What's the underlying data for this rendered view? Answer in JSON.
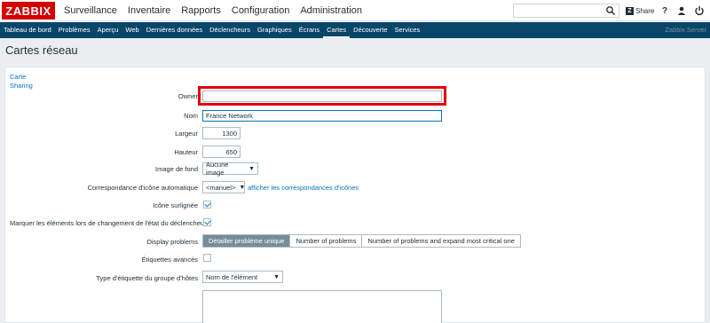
{
  "topbar": {
    "logo": "ZABBIX",
    "nav": [
      "Surveillance",
      "Inventaire",
      "Rapports",
      "Configuration",
      "Administration"
    ],
    "active_nav": "Surveillance",
    "share_label": "Share",
    "share_badge": "Z",
    "help_glyph": "?",
    "icons": [
      "search-icon",
      "help-icon",
      "user-icon",
      "power-icon"
    ]
  },
  "subnav": {
    "items": [
      "Tableau de bord",
      "Problèmes",
      "Aperçu",
      "Web",
      "Dernières données",
      "Déclencheurs",
      "Graphiques",
      "Écrans",
      "Cartes",
      "Découverte",
      "Services"
    ],
    "active": "Cartes",
    "server_name": "Zabbix Server"
  },
  "page": {
    "title": "Cartes réseau"
  },
  "tabs": [
    "Carte",
    "Sharing"
  ],
  "form": {
    "owner_label": "Owner",
    "owner_value": "",
    "name_label": "Nom",
    "name_value": "France Network",
    "width_label": "Largeur",
    "width_value": "1300",
    "height_label": "Hauteur",
    "height_value": "650",
    "background_label": "Image de fond",
    "background_value": "Aucune image",
    "icon_mapping_label": "Correspondance d'icône automatique",
    "icon_mapping_value": "<manuel>",
    "icon_mapping_link": "afficher les correspondances d'icônes",
    "icon_highlight_label": "Icône surlignée",
    "icon_highlight_checked": true,
    "mark_elements_label": "Marquer les éléments lors de changement de l'état du déclencheur",
    "mark_elements_checked": true,
    "display_problems_label": "Display problems",
    "display_problems_options": [
      "Détailler problème unique",
      "Number of problems",
      "Number of problems and expand most critical one"
    ],
    "display_problems_selected": "Détailler problème unique",
    "advanced_labels_label": "Étiquettes avancés",
    "advanced_labels_checked": false,
    "host_group_label_type_label": "Type d'étiquette du groupe d'hôtes",
    "host_group_label_type_value": "Nom de l'élément"
  },
  "colors": {
    "logo_red": "#d40000",
    "subnav_bg": "#0a466a",
    "highlight_red": "#e20000",
    "link_blue": "#0275b8",
    "selected_seg": "#768d99"
  }
}
